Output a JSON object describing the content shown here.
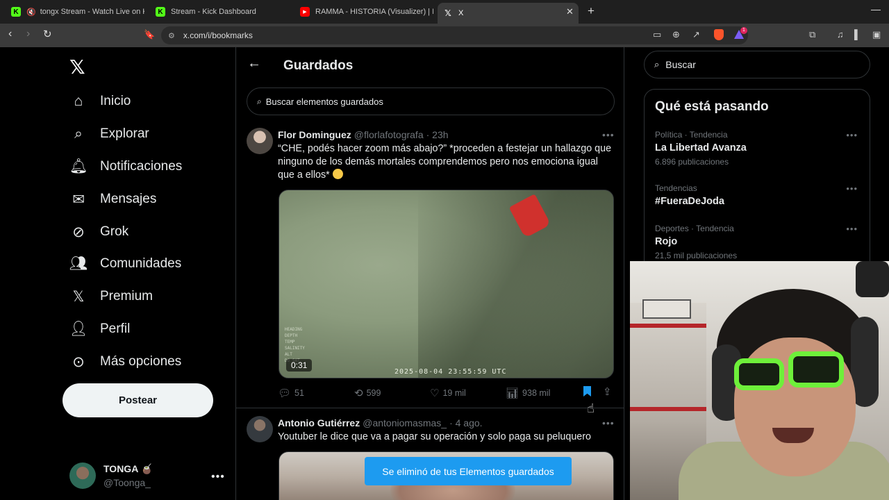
{
  "browser": {
    "tabs": [
      {
        "title": "tongx Stream - Watch Live on Kic",
        "favicon": "K",
        "muted": true
      },
      {
        "title": "Stream - Kick Dashboard",
        "favicon": "K",
        "muted": false
      },
      {
        "title": "RAMMA - HISTORIA (Visualizer) | INM",
        "favicon": "▶",
        "muted": false
      },
      {
        "title": "X",
        "favicon": "𝕏",
        "muted": false
      }
    ],
    "url": "x.com/i/bookmarks",
    "notification_count": "1"
  },
  "sidebar": {
    "logo": "𝕏",
    "items": [
      {
        "label": "Inicio",
        "icon": "home-icon"
      },
      {
        "label": "Explorar",
        "icon": "search-icon"
      },
      {
        "label": "Notificaciones",
        "icon": "bell-icon"
      },
      {
        "label": "Mensajes",
        "icon": "mail-icon"
      },
      {
        "label": "Grok",
        "icon": "grok-icon"
      },
      {
        "label": "Comunidades",
        "icon": "people-icon"
      },
      {
        "label": "Premium",
        "icon": "x-premium-icon"
      },
      {
        "label": "Perfil",
        "icon": "person-icon"
      },
      {
        "label": "Más opciones",
        "icon": "more-circle-icon"
      }
    ],
    "post_label": "Postear",
    "profile": {
      "name": "TONGA 🧉",
      "handle": "@Toonga_"
    }
  },
  "main": {
    "title": "Guardados",
    "search_placeholder": "Buscar elementos guardados",
    "tweets": [
      {
        "name": "Flor Dominguez",
        "handle": "@florlafotografa",
        "time": "· 23h",
        "text": "“CHE, podés hacer zoom más abajo?” *proceden a festejar un hallazgo que ninguno de los demás mortales comprendemos pero nos emociona igual que a ellos*",
        "video_duration": "0:31",
        "video_timestamp": "2025-08-04  23:55:59  UTC",
        "replies": "51",
        "reposts": "599",
        "likes": "19 mil",
        "views": "938 mil"
      },
      {
        "name": "Antonio Gutiérrez",
        "handle": "@antoniomasmas_",
        "time": "· 4 ago.",
        "text": "Youtuber le dice que va a pagar su operación y solo paga su peluquero"
      }
    ],
    "toast": "Se eliminó de tus Elementos guardados"
  },
  "right": {
    "search_placeholder": "Buscar",
    "trends_title": "Qué está pasando",
    "trends": [
      {
        "context": "Política · Tendencia",
        "topic": "La Libertad Avanza",
        "posts": "6.896 publicaciones"
      },
      {
        "context": "Tendencias",
        "topic": "#FueraDeJoda",
        "posts": ""
      },
      {
        "context": "Deportes · Tendencia",
        "topic": "Rojo",
        "posts": "21,5 mil publicaciones"
      }
    ]
  },
  "colors": {
    "accent": "#1d9bf0",
    "background": "#000000",
    "border": "#2f3336",
    "muted_text": "#71767b"
  }
}
